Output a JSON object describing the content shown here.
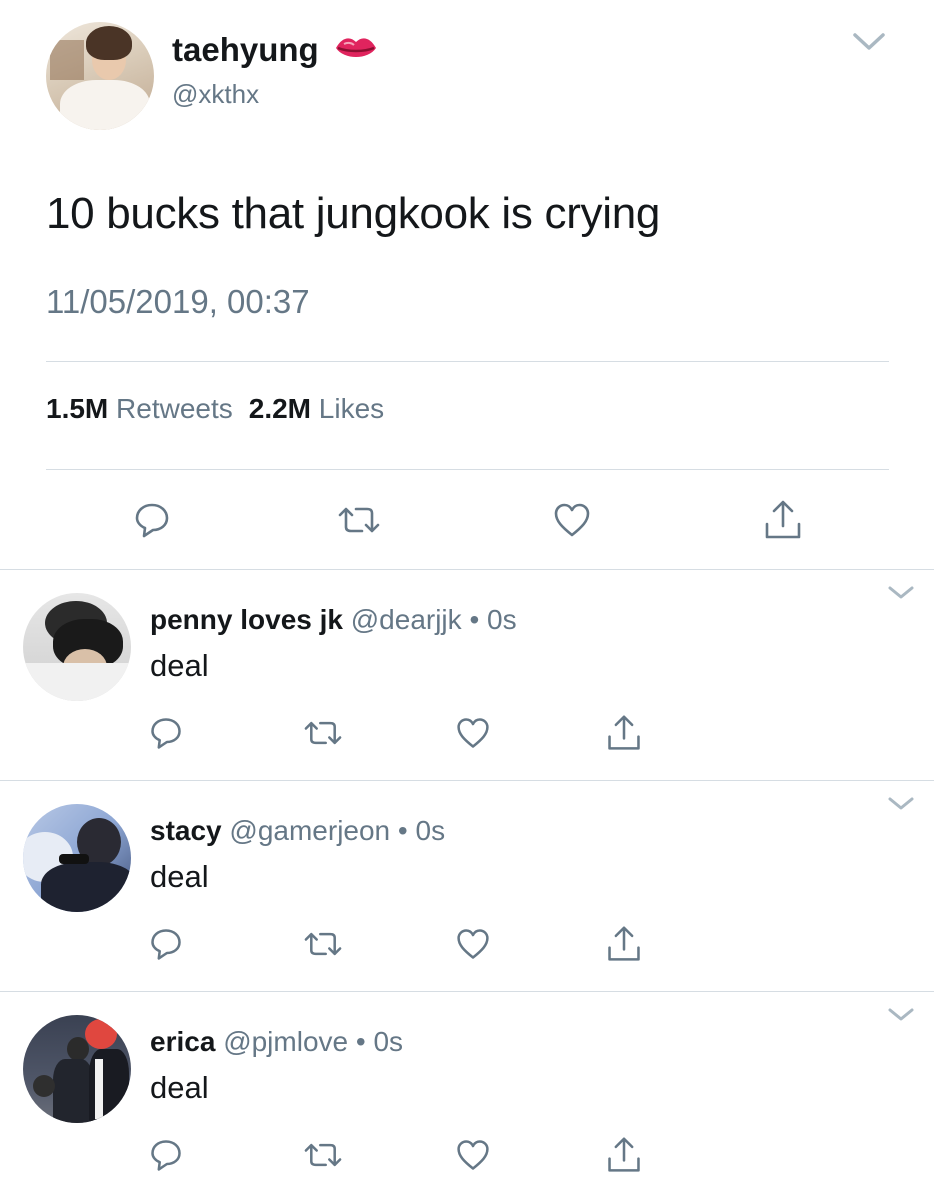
{
  "tweet": {
    "author_name": "taehyung",
    "author_badge_icon": "lips-kiss-icon",
    "author_handle": "@xkthx",
    "text": "10 bucks that jungkook is crying",
    "timestamp": "11/05/2019, 00:37",
    "retweets_count": "1.5M",
    "retweets_label": "Retweets",
    "likes_count": "2.2M",
    "likes_label": "Likes"
  },
  "replies": [
    {
      "name": "penny loves jk",
      "handle": "@dearjjk",
      "separator": "•",
      "time": "0s",
      "text": "deal"
    },
    {
      "name": "stacy",
      "handle": "@gamerjeon",
      "separator": "•",
      "time": "0s",
      "text": "deal"
    },
    {
      "name": "erica",
      "handle": "@pjmlove",
      "separator": "•",
      "time": "0s",
      "text": "deal"
    }
  ],
  "colors": {
    "text_primary": "#14171a",
    "text_secondary": "#657786",
    "icon": "#657786",
    "divider": "#d6dde3",
    "badge": "#e0245e"
  },
  "icons": [
    "chevron-down-icon",
    "reply-icon",
    "retweet-icon",
    "like-icon",
    "share-icon"
  ]
}
